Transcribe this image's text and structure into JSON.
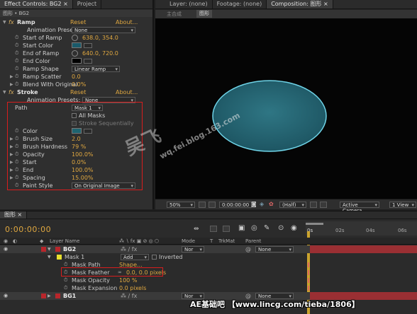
{
  "effect_controls": {
    "tabs": [
      "Effect Controls: BG2",
      "Project"
    ],
    "subheader": "图形 • BG2",
    "ramp": {
      "name": "Ramp",
      "reset": "Reset",
      "about": "About...",
      "animation_presets_label": "Animation Presets:",
      "animation_presets_value": "None",
      "start_of_ramp_label": "Start of Ramp",
      "start_of_ramp_value": "638.0, 354.0",
      "start_color_label": "Start Color",
      "start_color": "#1a5a6a",
      "end_of_ramp_label": "End of Ramp",
      "end_of_ramp_value": "640.0, 720.0",
      "end_color_label": "End Color",
      "end_color": "#000000",
      "ramp_shape_label": "Ramp Shape",
      "ramp_shape_value": "Linear Ramp",
      "ramp_scatter_label": "Ramp Scatter",
      "ramp_scatter_value": "0.0",
      "blend_label": "Blend With Original",
      "blend_value": "0.0%"
    },
    "stroke": {
      "name": "Stroke",
      "reset": "Reset",
      "about": "About...",
      "animation_presets_label": "Animation Presets:",
      "animation_presets_value": "None",
      "path_label": "Path",
      "path_value": "Mask 1",
      "all_masks_label": "All Masks",
      "stroke_seq_label": "Stroke Sequentially",
      "color_label": "Color",
      "color": "#1e6470",
      "brush_size_label": "Brush Size",
      "brush_size_value": "2.0",
      "brush_hardness_label": "Brush Hardness",
      "brush_hardness_value": "79 %",
      "opacity_label": "Opacity",
      "opacity_value": "100.0%",
      "start_label": "Start",
      "start_value": "0.0%",
      "end_label": "End",
      "end_value": "100.0%",
      "spacing_label": "Spacing",
      "spacing_value": "15.00%",
      "paint_style_label": "Paint Style",
      "paint_style_value": "On Original Image"
    }
  },
  "viewer": {
    "tabs": [
      "Layer: (none)",
      "Footage: (none)",
      "Composition: 图形"
    ],
    "comp_tabs": [
      "主合成",
      "图形"
    ],
    "zoom": "50%",
    "timecode": "0:00:00:00",
    "resolution": "(Half)",
    "camera": "Active Camera",
    "view": "1 View",
    "ellipse_fill": "#2a6a78",
    "ellipse_stroke": "#6fd4e8"
  },
  "timeline": {
    "tab": "图形",
    "timecode": "0:00:00:00",
    "columns": {
      "layer_name": "Layer Name",
      "mode": "Mode",
      "t": "T",
      "trkmat": "TrkMat",
      "parent": "Parent"
    },
    "ruler": [
      "0s",
      "02s",
      "04s",
      "06s"
    ],
    "layers": [
      {
        "name": "BG2",
        "mode": "Nor",
        "parent": "None"
      },
      {
        "name": "BG1",
        "mode": "Nor",
        "parent": "None"
      }
    ],
    "mask": {
      "name": "Mask 1",
      "mode": "Add",
      "inverted_label": "Inverted",
      "path_label": "Mask Path",
      "path_value": "Shape...",
      "feather_label": "Mask Feather",
      "feather_value": "0.0, 0.0 pixels",
      "opacity_label": "Mask Opacity",
      "opacity_value": "100 %",
      "expansion_label": "Mask Expansion",
      "expansion_value": "0.0 pixels"
    },
    "none_label": "None"
  },
  "watermarks": {
    "center": "吴飞",
    "center_url": "wq.fei.blog.163.com",
    "bottom": "AE基础吧 【www.lincg.com/tieba/1806】"
  }
}
